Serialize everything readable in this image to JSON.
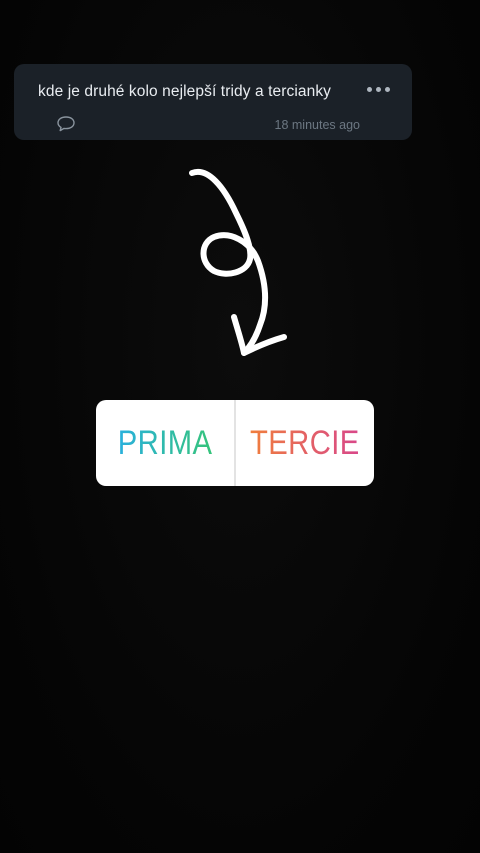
{
  "comment": {
    "text": "kde je druhé kolo nejlepší tridy a tercianky",
    "timestamp": "18 minutes ago",
    "reply_icon": "speech-bubble-icon",
    "more_icon": "ellipsis-icon"
  },
  "arrow": {
    "icon": "hand-drawn-curly-arrow-down",
    "color": "#ffffff"
  },
  "poll": {
    "options": [
      {
        "label": "PRIMA",
        "gradient": [
          "#2ab0dd",
          "#35c47a"
        ]
      },
      {
        "label": "TERCIE",
        "gradient": [
          "#f07e3c",
          "#d8478a"
        ]
      }
    ]
  },
  "colors": {
    "background": "#060606",
    "card": "#1b2128",
    "card_text": "#e9edf1",
    "muted_text": "#6c7782"
  }
}
